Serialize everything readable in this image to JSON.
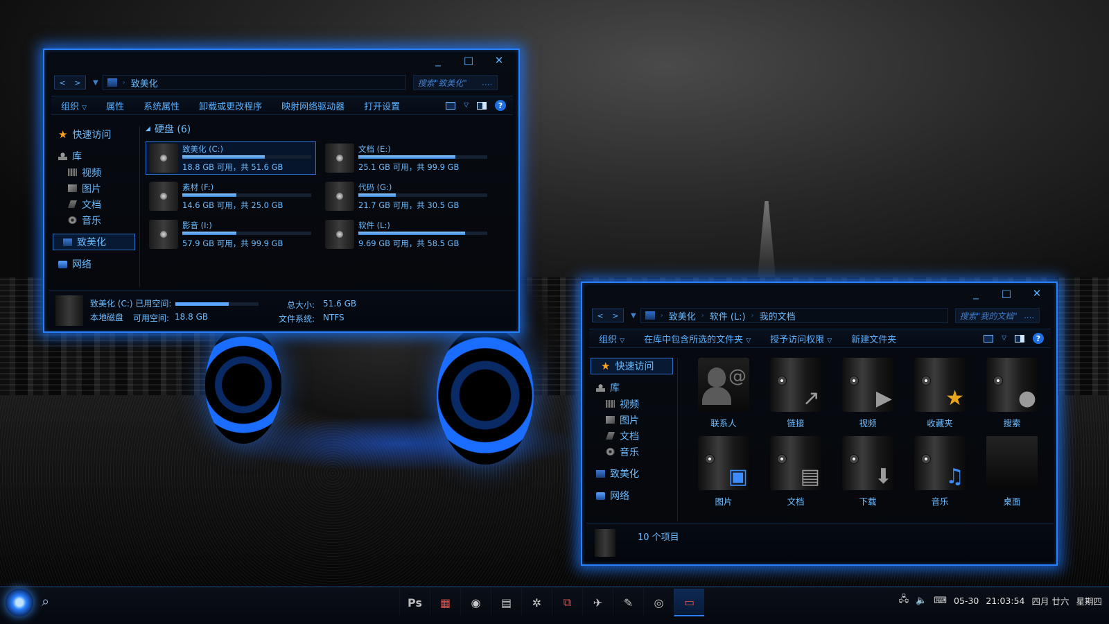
{
  "window1": {
    "address": "致美化",
    "search_placeholder": "搜索\"致美化\"",
    "search_more": "....",
    "toolbar": [
      "组织",
      "属性",
      "系统属性",
      "卸载或更改程序",
      "映射网络驱动器",
      "打开设置"
    ],
    "sidebar": [
      {
        "label": "快速访问",
        "icon": "star-icon",
        "level": 0
      },
      {
        "label": "库",
        "icon": "library-icon",
        "level": 0
      },
      {
        "label": "视频",
        "icon": "video-icon",
        "level": 1
      },
      {
        "label": "图片",
        "icon": "picture-icon",
        "level": 1
      },
      {
        "label": "文档",
        "icon": "document-icon",
        "level": 1
      },
      {
        "label": "音乐",
        "icon": "music-icon",
        "level": 1
      },
      {
        "label": "致美化",
        "icon": "computer-icon",
        "level": 0,
        "selected": true
      },
      {
        "label": "网络",
        "icon": "network-icon",
        "level": 0
      }
    ],
    "group_title": "硬盘 (6)",
    "drives": [
      {
        "name": "致美化 (C:)",
        "free": "18.8 GB 可用，共 51.6 GB",
        "used_fraction": 0.64,
        "selected": true
      },
      {
        "name": "文档 (E:)",
        "free": "25.1 GB 可用，共 99.9 GB",
        "used_fraction": 0.75
      },
      {
        "name": "素材 (F:)",
        "free": "14.6 GB 可用，共 25.0 GB",
        "used_fraction": 0.42
      },
      {
        "name": "代码 (G:)",
        "free": "21.7 GB 可用，共 30.5 GB",
        "used_fraction": 0.29
      },
      {
        "name": "影音 (I:)",
        "free": "57.9 GB 可用，共 99.9 GB",
        "used_fraction": 0.42
      },
      {
        "name": "软件 (L:)",
        "free": "9.69 GB 可用，共 58.5 GB",
        "used_fraction": 0.83
      }
    ],
    "details": {
      "name_label": "致美化 (C:) 已用空间:",
      "type_label": "本地磁盘",
      "free_label": "可用空间:",
      "free_value": "18.8 GB",
      "total_label": "总大小:",
      "total_value": "51.6 GB",
      "fs_label": "文件系统:",
      "fs_value": "NTFS",
      "used_fraction": 0.64
    }
  },
  "window2": {
    "breadcrumb": [
      "致美化",
      "软件 (L:)",
      "我的文档"
    ],
    "search_placeholder": "搜索\"我的文档\"",
    "search_more": "....",
    "toolbar": [
      "组织",
      "在库中包含所选的文件夹",
      "授予访问权限",
      "新建文件夹"
    ],
    "sidebar": [
      {
        "label": "快速访问",
        "icon": "star-icon",
        "level": 0,
        "selected": true
      },
      {
        "label": "库",
        "icon": "library-icon",
        "level": 0
      },
      {
        "label": "视频",
        "icon": "video-icon",
        "level": 1
      },
      {
        "label": "图片",
        "icon": "picture-icon",
        "level": 1
      },
      {
        "label": "文档",
        "icon": "document-icon",
        "level": 1
      },
      {
        "label": "音乐",
        "icon": "music-icon",
        "level": 1
      },
      {
        "label": "致美化",
        "icon": "computer-icon",
        "level": 0
      },
      {
        "label": "网络",
        "icon": "network-icon",
        "level": 0
      }
    ],
    "items": [
      {
        "label": "联系人",
        "icon": "contacts-icon"
      },
      {
        "label": "链接",
        "icon": "links-icon"
      },
      {
        "label": "视频",
        "icon": "videos-folder-icon"
      },
      {
        "label": "收藏夹",
        "icon": "favorites-icon"
      },
      {
        "label": "搜索",
        "icon": "searches-icon"
      },
      {
        "label": "图片",
        "icon": "pictures-folder-icon"
      },
      {
        "label": "文档",
        "icon": "documents-folder-icon"
      },
      {
        "label": "下载",
        "icon": "downloads-folder-icon"
      },
      {
        "label": "音乐",
        "icon": "music-folder-icon"
      },
      {
        "label": "桌面",
        "icon": "desktop-folder-icon"
      }
    ],
    "status": "10 个项目"
  },
  "taskbar": {
    "apps": [
      "Ps",
      "app-grid-icon",
      "camera-icon",
      "notepad-icon",
      "gear-icon",
      "screen-capture-icon",
      "plane-icon",
      "pen-icon",
      "chrome-icon",
      "remote-desktop-icon"
    ],
    "date": "05-30",
    "time": "21:03:54",
    "lunar": "四月 廿六",
    "weekday": "星期四"
  },
  "colors": {
    "accent": "#2a7fff",
    "text": "#5ab0ff",
    "star": "#ffa41c"
  }
}
